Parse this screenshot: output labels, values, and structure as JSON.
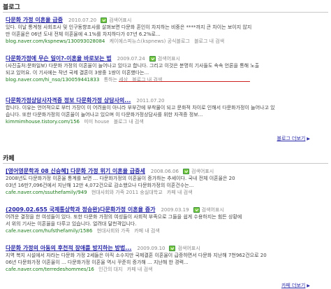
{
  "blog": {
    "section_title": "블로그",
    "more_label": "블로그 더보기",
    "results": [
      {
        "title": "다문화 가정 이혼율 급증",
        "date": "2010.07.20",
        "cache_label": "검색어표시",
        "lines": [
          "있다. 이날 통계청 사회조사 및 인구동향조사를 살펴보면 다문화 혼인이 차지하는 비중은 ****까지 큰 차이는 보이지 않지",
          "만 이혼율은 06년 도내 전체 이혼율에 4.1%를 차지하다가 07년 6.2%로..."
        ],
        "url": "blog.naver.com/kspnews/130093028084",
        "source": "케이에스피뉴스(kspnews) 공식블로그",
        "more": "블로그 내 검색"
      },
      {
        "title": "다문화가정에 무슨 일이?-이혼율 바로보는 법",
        "date": "2009.07.24",
        "cache_label": "검색어표시",
        "lines": [
          "(사진출처:문화일보) 다문화 가정의 이혼율이 늘어나고 있다고 합니다. 그리고 이것은 분명히 기사들도 속속 언론을 통해 노출",
          "되고 있어요. 이 기사에는 작년 국제 결혼이 3쌍중 1쌍이 이혼했다는..."
        ],
        "url": "blog.naver.com/hi_nso/130059441833",
        "source": "통하는 세상",
        "more": "블로그 내 검색"
      },
      {
        "title": "다문화가정상담사자격증 정보 다문화가정 상담사의...",
        "date": "2011.07.20",
        "cache_label": "",
        "lines": [
          "합니다. 이유는 언어적으로 부터 가장이 이 어려움이 아니라 부부간에 부착물이 되고 문화적 차이로 인해서 다문화가정이 늘어나고 있",
          "습니다. 또한 다문화가정의 이혼율이 늘어나고 있으며 이 다문화가정상담사를 위한 자격증 정보..."
        ],
        "url": "kimmimhouse.tistory.com/156",
        "source": "미미 house",
        "more": "블로그 내 검색"
      }
    ]
  },
  "cafe": {
    "section_title": "카페",
    "more_label": "카페 더보기",
    "results": [
      {
        "title": "[영어영문학과 08 신승혜] 다문화 가정 위기 이혼율 급증세",
        "date": "2008.06.06",
        "cache_label": "검색어표시",
        "lines": [
          "2008년도 다문화가정 이혼율 통계를 보면 ... 다문화가정의 이혼율이 증가하는 추세이다. 국내 전체 이혼율은 20",
          "03년 16만7,096건에서 지난해 12만 4,072건으로 감소했으나 다문화가정의 이혼건수는..."
        ],
        "url": "cafe.naver.com/ssuthefamily/949",
        "source": "현대사회와 가족 2011 숭실대학교",
        "more": "카페 내 검색"
      },
      {
        "title": "(2009.02.655 국제통상학과 정승완)다문화가정 이혼율 증가",
        "date": "2009.03.19",
        "cache_label": "검색어표시",
        "lines": [
          "어려운 결정을 한 여성들이 있다. 또한 다문화 가정의 여성들이 사회적 부족으로 그들을 쉽게 수용하지는 힘든 상황에",
          "서 위의 기사는 이혼율을 다루고 있습니다. 얼려대 달천격입니다."
        ],
        "url": "cafe.naver.com/hufsthefamily/1586",
        "source": "현대사회와 가족",
        "more": "카페 내 검색"
      },
      {
        "title": "다문화 가정의 아동의 후천적 장애를 방지하는 방법...",
        "date": "2009.09.10",
        "cache_label": "검색어표시",
        "lines": [
          "지역 복지 시설에서 자라는 다문화 가정 2세들은 아직 소수지만 국제결혼 이혼율이 급증하면서 다문화 지난해 7천962건으로 20",
          "06년 다문화가정 이혼율이 ... 다문화가정 이혼율 역시 꾸준히 증가해 ... 지난해 한 경력..."
        ],
        "url": "cafe.naver.com/terredeshommes/16",
        "source": "인간의 대지",
        "more": "카페 내 검색"
      }
    ]
  },
  "colors": {
    "link": "#2a2aa8",
    "url": "#1a7a1a",
    "highlight_line": "#cc2222"
  }
}
